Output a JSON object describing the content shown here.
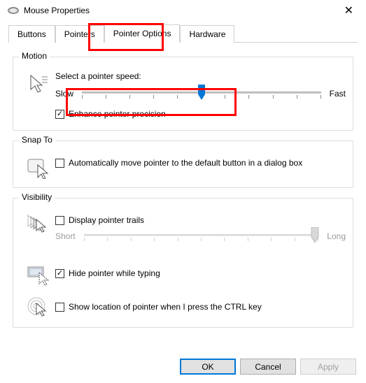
{
  "window": {
    "title": "Mouse Properties"
  },
  "tabs": {
    "buttons": "Buttons",
    "pointers": "Pointers",
    "pointer_options": "Pointer Options",
    "hardware": "Hardware"
  },
  "motion": {
    "legend": "Motion",
    "select_label": "Select a pointer speed:",
    "slow": "Slow",
    "fast": "Fast",
    "enhance_label": "Enhance pointer precision",
    "enhance_checked": true,
    "speed_ticks": 11,
    "speed_index": 5
  },
  "snap_to": {
    "legend": "Snap To",
    "auto_label": "Automatically move pointer to the default button in a dialog box",
    "auto_checked": false
  },
  "visibility": {
    "legend": "Visibility",
    "trails_label": "Display pointer trails",
    "trails_checked": false,
    "short": "Short",
    "long": "Long",
    "hide_label": "Hide pointer while typing",
    "hide_checked": true,
    "ctrl_label": "Show location of pointer when I press the CTRL key",
    "ctrl_checked": false
  },
  "buttons_bar": {
    "ok": "OK",
    "cancel": "Cancel",
    "apply": "Apply"
  },
  "colors": {
    "highlight_red": "#ff0000",
    "blue_thumb": "#0078d7"
  }
}
